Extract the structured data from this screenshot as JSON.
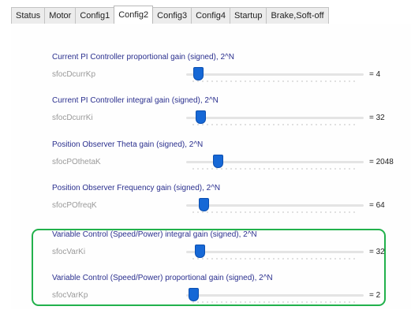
{
  "tabs": [
    {
      "label": "Status",
      "active": false
    },
    {
      "label": "Motor",
      "active": false
    },
    {
      "label": "Config1",
      "active": false
    },
    {
      "label": "Config2",
      "active": true
    },
    {
      "label": "Config3",
      "active": false
    },
    {
      "label": "Config4",
      "active": false
    },
    {
      "label": "Startup",
      "active": false
    },
    {
      "label": "Brake,Soft-off",
      "active": false
    }
  ],
  "params": [
    {
      "title": "Current PI Controller proportional gain (signed), 2^N",
      "name": "sfocDcurrKp",
      "value": "= 4"
    },
    {
      "title": "Current PI Controller integral gain (signed), 2^N",
      "name": "sfocDcurrKi",
      "value": "= 32"
    },
    {
      "title": "Position Observer Theta gain (signed), 2^N",
      "name": "sfocPOthetaK",
      "value": "= 2048"
    },
    {
      "title": "Position Observer Frequency gain (signed), 2^N",
      "name": "sfocPOfreqK",
      "value": "= 64"
    },
    {
      "title": "Variable Control (Speed/Power) integral gain (signed), 2^N",
      "name": "sfocVarKi",
      "value": "= 32"
    },
    {
      "title": "Variable Control (Speed/Power) proportional gain (signed), 2^N",
      "name": "sfocVarKp",
      "value": "= 2"
    }
  ],
  "colors": {
    "accent": "#1668d6",
    "title_text": "#2a2f8e",
    "highlight_border": "#22b14c"
  }
}
